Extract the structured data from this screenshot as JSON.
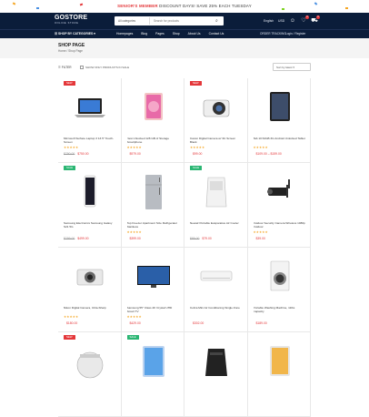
{
  "promo": {
    "prefix": "SENIOR'S MEMBER",
    "text": " DISCOUNT DAYS! SAVE 25% EACH TUESDAY"
  },
  "brand": {
    "name": "GOSTORE",
    "tagline": "ONLINE STORE",
    "accent": "#e4373a",
    "navy": "#0b1d3a"
  },
  "search": {
    "category": "All categories",
    "placeholder": "Search for products"
  },
  "topright": {
    "language": "English",
    "currency": "USD",
    "wishlist_count": "0",
    "cart_count": "0"
  },
  "nav": {
    "browse": "SHOP BY CATEGORIES",
    "items": [
      "Homepages",
      "Blog",
      "Pages",
      "Shop",
      "About Us",
      "Contact Us"
    ],
    "tracking": "ORDER TRACKING",
    "login": "Login / Register"
  },
  "page": {
    "title": "SHOP PAGE",
    "breadcrumb": "Home / Shop Page"
  },
  "toolbar": {
    "filter": "FILTER",
    "in_stock": "SHOW ONLY PRODUCTS IN SALE",
    "sort": "Sort by latest"
  },
  "products": [
    {
      "tag": "NEW",
      "title": "Microsoft Surface Laptop 3 13.5\" Touch-Screen",
      "stars": "★★★★★",
      "old": "$790.00",
      "price": "$750.00",
      "icon": "laptop-icon"
    },
    {
      "tag": "",
      "title": "New Unlocked 128 GB of Storage Smartphone",
      "stars": "★★★★★",
      "old": "",
      "price": "$979.00",
      "icon": "tablet-icon"
    },
    {
      "tag": "NEW",
      "title": "Canon Digital Camera w/ 3in Screen Black",
      "stars": "★★★★★",
      "old": "",
      "price": "$99.00",
      "icon": "camera-icon"
    },
    {
      "tag": "",
      "title": "Tab 10 64GB 3G Android Unlocked Tablet",
      "stars": "★★★★★",
      "old": "",
      "price": "$109.00 – $159.00",
      "icon": "tablet-black-icon"
    },
    {
      "tag": "SALE",
      "title": "Samsung Electronics Samsung Galaxy S21 5G",
      "stars": "",
      "old": "$799.00",
      "price": "$499.00",
      "icon": "phone-icon"
    },
    {
      "tag": "",
      "title": "Top Freezer Apartment Size Refrigerator Stainless",
      "stars": "★★★★★",
      "old": "",
      "price": "$399.00",
      "icon": "fridge-icon"
    },
    {
      "tag": "SALE",
      "title": "Newair Portable Evaporative Air Cooler",
      "stars": "",
      "old": "$89.00",
      "price": "$79.00",
      "icon": "air-cooler-icon"
    },
    {
      "tag": "",
      "title": "Outdoor Security Camera Wireless 1080p Outdoor",
      "stars": "★★★★★",
      "old": "",
      "price": "$39.00",
      "icon": "security-camera-icon"
    },
    {
      "tag": "",
      "title": "Nikon Digital Camera, Ultra-Sharp",
      "stars": "★★★★★",
      "old": "",
      "price": "$180.00",
      "icon": "compact-camera-icon"
    },
    {
      "tag": "",
      "title": "Samsung 55\" Class 4K Crystal UHD Smart TV",
      "stars": "★★★★★",
      "old": "",
      "price": "$429.00",
      "icon": "tv-icon"
    },
    {
      "tag": "",
      "title": "Cobra Mini Air Conditioning Single Zone",
      "stars": "",
      "old": "",
      "price": "$302.00",
      "icon": "air-conditioner-icon"
    },
    {
      "tag": "",
      "title": "Portable Washing Machine, 11lbs Capacity",
      "stars": "",
      "old": "",
      "price": "$189.00",
      "icon": "washer-icon"
    },
    {
      "tag": "NEW",
      "title": "",
      "stars": "",
      "old": "",
      "price": "",
      "icon": "rice-cooker-icon"
    },
    {
      "tag": "SALE",
      "title": "",
      "stars": "",
      "old": "",
      "price": "",
      "icon": "ipad-blue-icon"
    },
    {
      "tag": "",
      "title": "",
      "stars": "",
      "old": "",
      "price": "",
      "icon": "air-fryer-icon"
    },
    {
      "tag": "",
      "title": "",
      "stars": "",
      "old": "",
      "price": "",
      "icon": "ipad-silver-icon"
    }
  ]
}
